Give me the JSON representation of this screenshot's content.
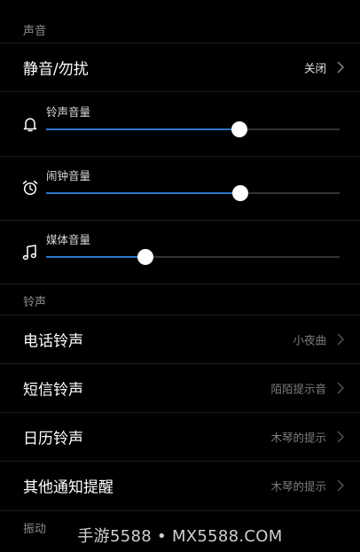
{
  "sections": {
    "sound": "声音",
    "ringtone": "铃声",
    "vibration": "振动"
  },
  "mute": {
    "label": "静音/勿扰",
    "value": "关闭"
  },
  "volumes": [
    {
      "label": "铃声音量",
      "icon": "bell-icon",
      "level": 0.66
    },
    {
      "label": "闹钟音量",
      "icon": "alarm-clock-icon",
      "level": 0.663
    },
    {
      "label": "媒体音量",
      "icon": "music-note-icon",
      "level": 0.338
    }
  ],
  "ringtones": [
    {
      "label": "电话铃声",
      "value": "小夜曲"
    },
    {
      "label": "短信铃声",
      "value": "陌陌提示音"
    },
    {
      "label": "日历铃声",
      "value": "木琴的提示"
    },
    {
      "label": "其他通知提醒",
      "value": "木琴的提示"
    }
  ],
  "watermark": "手游5588 • MX5588.COM",
  "colors": {
    "accent": "#2d78c8",
    "background": "#000000"
  }
}
